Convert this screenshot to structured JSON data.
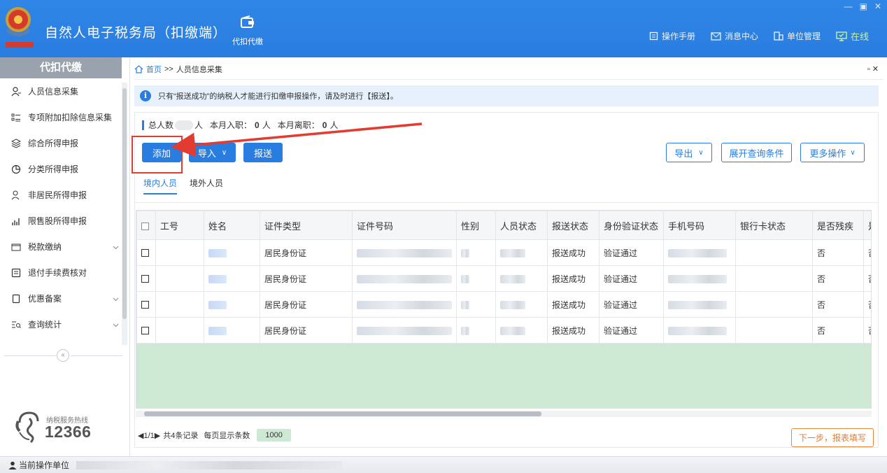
{
  "header": {
    "app_title": "自然人电子税务局（扣缴端）",
    "module_tab": "代扣代缴",
    "links": [
      {
        "label": "操作手册",
        "icon": "manual-icon"
      },
      {
        "label": "消息中心",
        "icon": "message-icon"
      },
      {
        "label": "单位管理",
        "icon": "building-icon"
      },
      {
        "label": "在线",
        "icon": "monitor-icon"
      }
    ],
    "win_controls": [
      "—",
      "▣",
      "✕"
    ]
  },
  "sidebar": {
    "title": "代扣代缴",
    "items": [
      {
        "label": "人员信息采集",
        "icon": "person-icon",
        "expandable": false
      },
      {
        "label": "专项附加扣除信息采集",
        "icon": "list-icon",
        "expandable": false
      },
      {
        "label": "综合所得申报",
        "icon": "layers-icon",
        "expandable": false
      },
      {
        "label": "分类所得申报",
        "icon": "pie-icon",
        "expandable": false
      },
      {
        "label": "非居民所得申报",
        "icon": "user-outline-icon",
        "expandable": false
      },
      {
        "label": "限售股所得申报",
        "icon": "bar-chart-icon",
        "expandable": false
      },
      {
        "label": "税款缴纳",
        "icon": "folder-icon",
        "expandable": true
      },
      {
        "label": "退付手续费核对",
        "icon": "receipt-icon",
        "expandable": false
      },
      {
        "label": "优惠备案",
        "icon": "document-icon",
        "expandable": true
      },
      {
        "label": "查询统计",
        "icon": "search-list-icon",
        "expandable": true
      }
    ],
    "collapse_glyph": "«",
    "hotline_label": "纳税服务热线",
    "hotline_number": "12366"
  },
  "breadcrumb": {
    "home": "首页",
    "sep": ">>",
    "current": "人员信息采集",
    "close_glyph": "▫ ✕"
  },
  "notice": {
    "icon": "i",
    "text": "只有“报送成功”的纳税人才能进行扣缴申报操作，请及时进行【报送】。"
  },
  "stats": {
    "total_label": "总人数",
    "unit": "人",
    "hired_label": "本月入职：",
    "hired_value": "0",
    "left_label": "本月离职：",
    "left_value": "0"
  },
  "toolbar": {
    "add": "添加",
    "import": "导入",
    "submit": "报送",
    "export": "导出",
    "expand_query": "展开查询条件",
    "more": "更多操作",
    "caret": "∨"
  },
  "tabs": [
    {
      "label": "境内人员",
      "active": true
    },
    {
      "label": "境外人员",
      "active": false
    }
  ],
  "table": {
    "columns": [
      "工号",
      "姓名",
      "证件类型",
      "证件号码",
      "性别",
      "人员状态",
      "报送状态",
      "身份验证状态",
      "手机号码",
      "银行卡状态",
      "是否残疾",
      "是"
    ],
    "rows": [
      {
        "id_type": "居民身份证",
        "submit_status": "报送成功",
        "verify_status": "验证通过",
        "disabled": "否",
        "trunc": "否"
      },
      {
        "id_type": "居民身份证",
        "submit_status": "报送成功",
        "verify_status": "验证通过",
        "disabled": "否",
        "trunc": "否"
      },
      {
        "id_type": "居民身份证",
        "submit_status": "报送成功",
        "verify_status": "验证通过",
        "disabled": "否",
        "trunc": "否"
      },
      {
        "id_type": "居民身份证",
        "submit_status": "报送成功",
        "verify_status": "验证通过",
        "disabled": "否",
        "trunc": "否"
      }
    ]
  },
  "pager": {
    "page": "◀1/1▶",
    "total": "共4条记录",
    "size_label": "每页显示条数",
    "size": "1000"
  },
  "next_button": "下一步，报表填写",
  "footer": {
    "label": "当前操作单位"
  },
  "colors": {
    "primary": "#2a7de0",
    "highlight": "#e23b30",
    "next": "#e8792c",
    "grid_empty": "#cde8d3"
  }
}
